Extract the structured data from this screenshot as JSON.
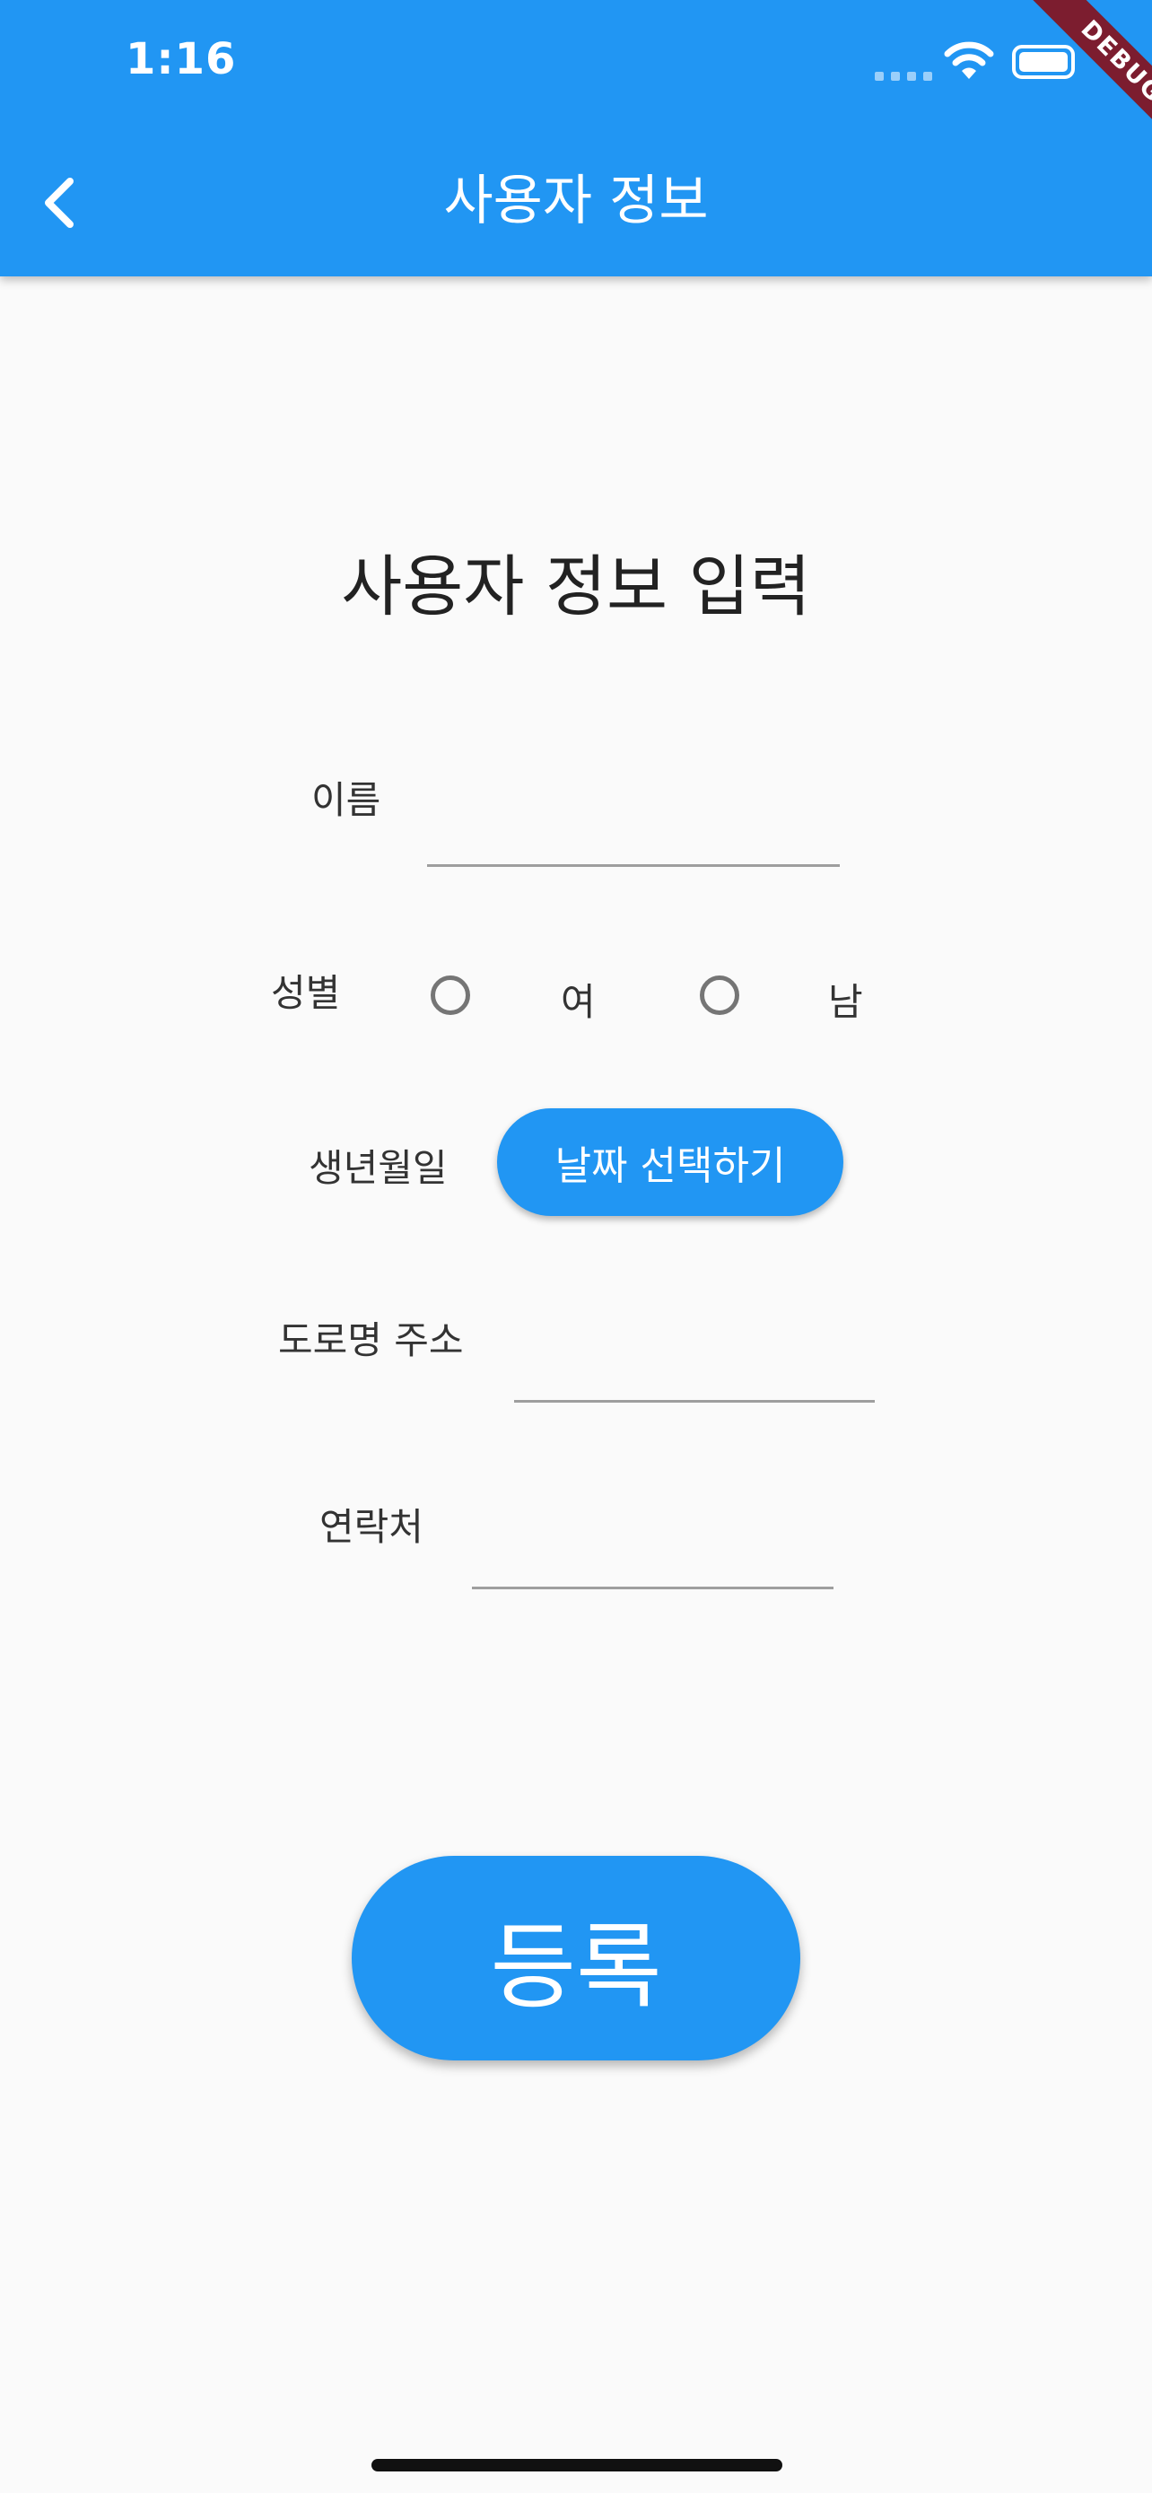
{
  "status_bar": {
    "time": "1:16",
    "icons": [
      "cellular-signal-icon",
      "wifi-icon",
      "battery-icon"
    ]
  },
  "app_bar": {
    "title": "사용자 정보",
    "back_icon": "chevron-left-icon",
    "color": "#2196f3"
  },
  "debug_banner": "DEBUG",
  "form": {
    "heading": "사용자 정보 입력",
    "name": {
      "label": "이름",
      "value": ""
    },
    "gender": {
      "label": "성별",
      "options": [
        "여",
        "남"
      ],
      "selected": null
    },
    "birthdate": {
      "label": "생년월일",
      "button_label": "날짜 선택하기"
    },
    "address": {
      "label": "도로명 주소",
      "value": ""
    },
    "contact": {
      "label": "연락처",
      "value": ""
    },
    "submit_label": "등록"
  },
  "colors": {
    "primary": "#2196f3",
    "background": "#fafafa",
    "ribbon": "#7c1d2f"
  }
}
